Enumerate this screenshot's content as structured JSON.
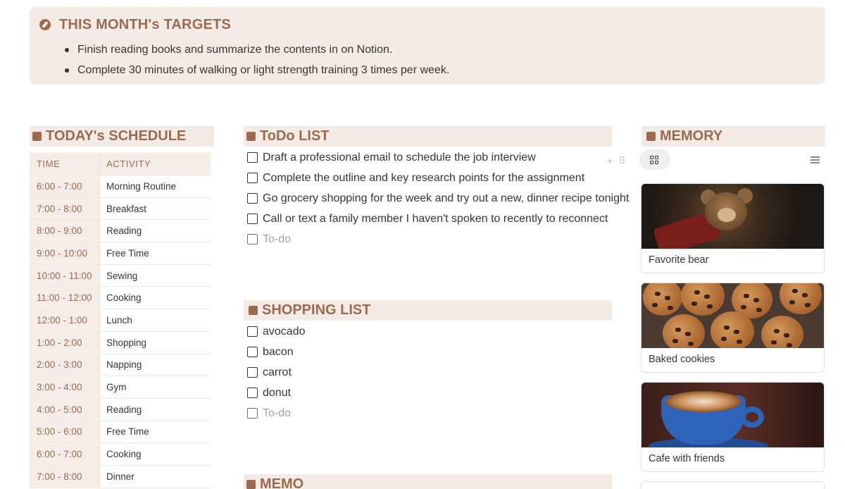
{
  "targets": {
    "title": "THIS MONTH's TARGETS",
    "items": [
      "Finish reading books and summarize the contents in on Notion.",
      "Complete 30 minutes of walking or light strength training 3 times per week."
    ]
  },
  "schedule": {
    "title": "TODAY's SCHEDULE",
    "columns": [
      "TIME",
      "ACTIVITY"
    ],
    "rows": [
      [
        "6:00 - 7:00",
        "Morning Routine"
      ],
      [
        "7:00 - 8:00",
        "Breakfast"
      ],
      [
        "8:00 - 9:00",
        "Reading"
      ],
      [
        "9:00 - 10:00",
        "Free Time"
      ],
      [
        "10:00 - 11:00",
        "Sewing"
      ],
      [
        "11:00 - 12:00",
        "Cooking"
      ],
      [
        "12:00 - 1:00",
        "Lunch"
      ],
      [
        "1:00 - 2:00",
        "Shopping"
      ],
      [
        "2:00 - 3:00",
        "Napping"
      ],
      [
        "3:00 - 4:00",
        "Gym"
      ],
      [
        "4:00 - 5:00",
        "Reading"
      ],
      [
        "5:00 - 6:00",
        "Free Time"
      ],
      [
        "6:00 - 7:00",
        "Cooking"
      ],
      [
        "7:00 - 8:00",
        "Dinner"
      ]
    ]
  },
  "todo": {
    "title": "ToDo LIST",
    "items": [
      "Draft a professional email to schedule the job interview",
      "Complete the outline and key research points for the assignment",
      "Go grocery shopping for the week and try out a new, dinner recipe tonight",
      "Call or text a family member I haven't spoken to recently to reconnect"
    ],
    "placeholder": "To-do"
  },
  "shopping": {
    "title": "SHOPPING LIST",
    "items": [
      "avocado",
      "bacon",
      "carrot",
      "donut"
    ],
    "placeholder": "To-do"
  },
  "memo": {
    "title": "MEMO"
  },
  "memory": {
    "title": "MEMORY",
    "cards": [
      {
        "caption": "Favorite bear"
      },
      {
        "caption": "Baked cookies"
      },
      {
        "caption": "Cafe with friends"
      }
    ]
  },
  "colors": {
    "accent": "#9c6a4f",
    "header_bg": "#f5ebe6",
    "text": "#37352f",
    "placeholder": "#a5a29e"
  },
  "icons": [
    "compass-icon",
    "grid-view-icon",
    "filter-icon",
    "plus-icon",
    "drag-handle-icon",
    "checkbox-icon"
  ]
}
